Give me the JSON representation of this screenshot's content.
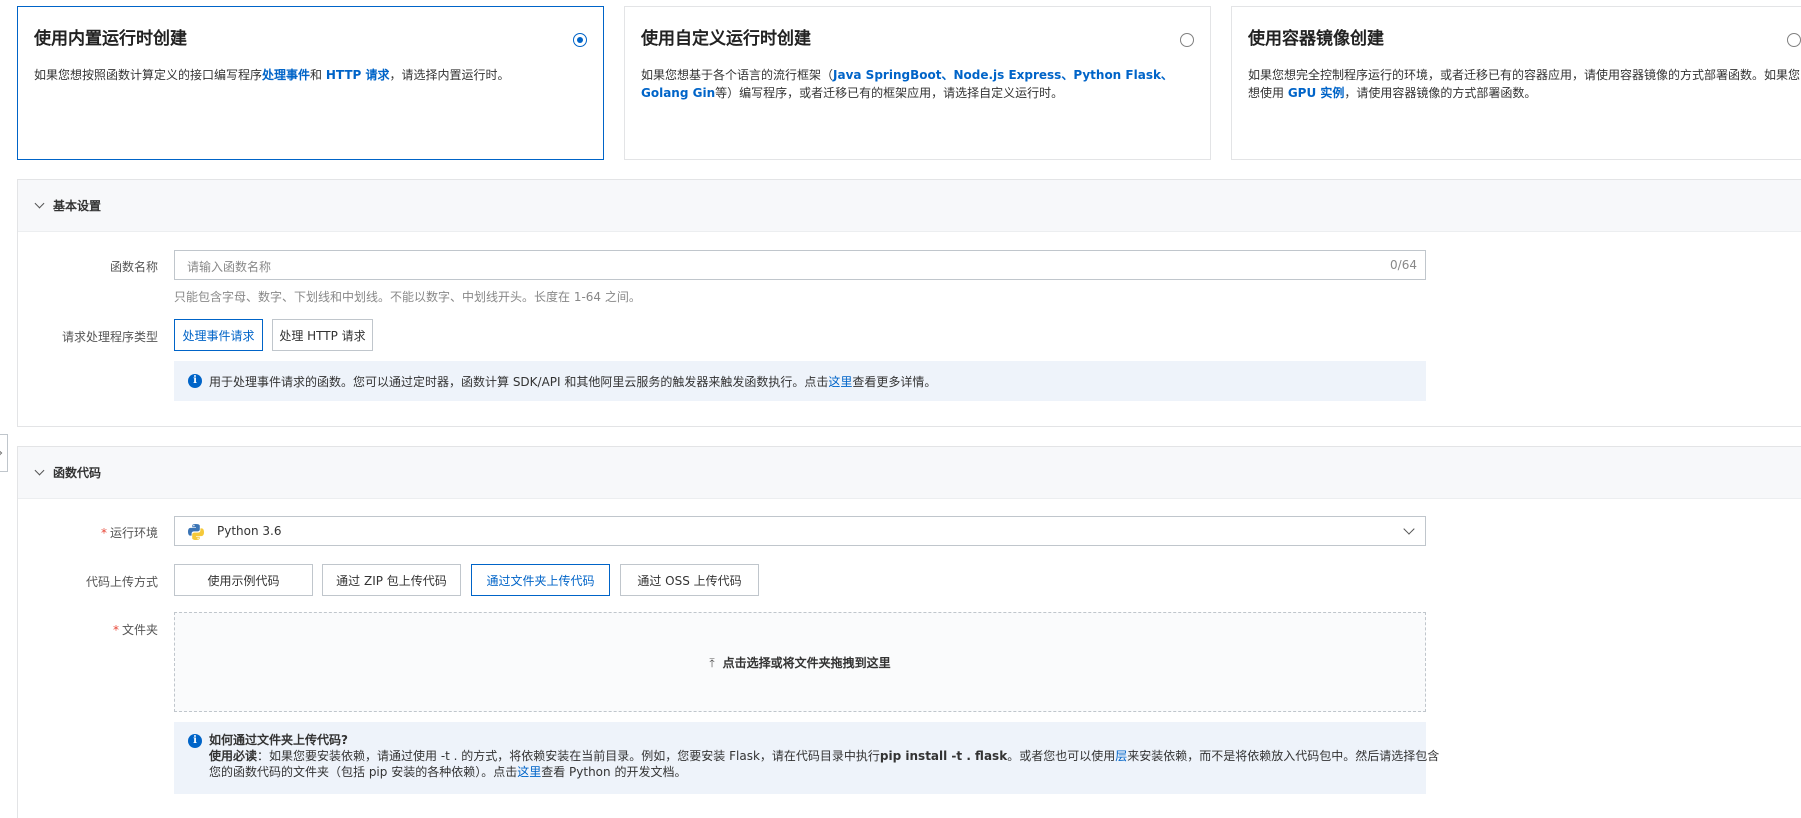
{
  "cards": [
    {
      "title": "使用内置运行时创建",
      "desc_pre": "如果您想按照函数计算定义的接口编写程序",
      "link1": "处理事件",
      "desc_mid": "和 ",
      "link2": "HTTP 请求",
      "desc_post": "，请选择内置运行时。",
      "selected": true
    },
    {
      "title": "使用自定义运行时创建",
      "desc_pre": "如果您想基于各个语言的流行框架（",
      "frameworks": "Java SpringBoot、Node.js Express、Python Flask、Golang Gin",
      "desc_post": "等）编写程序，或者迁移已有的框架应用，请选择自定义运行时。",
      "selected": false
    },
    {
      "title": "使用容器镜像创建",
      "desc_pre": "如果您想完全控制程序运行的环境，或者迁移已有的容器应用，请使用容器镜像的方式部署函数。如果您想使用 ",
      "link1": "GPU 实例",
      "desc_post": "，请使用容器镜像的方式部署函数。",
      "selected": false
    }
  ],
  "basic": {
    "title": "基本设置",
    "name_label": "函数名称",
    "name_placeholder": "请输入函数名称",
    "name_count": "0/64",
    "name_hint": "只能包含字母、数字、下划线和中划线。不能以数字、中划线开头。长度在 1-64 之间。",
    "handler_label": "请求处理程序类型",
    "handler_options": [
      "处理事件请求",
      "处理 HTTP 请求"
    ],
    "notice_pre": "用于处理事件请求的函数。您可以通过定时器，函数计算 SDK/API 和其他阿里云服务的触发器来触发函数执行。点击",
    "notice_link": "这里",
    "notice_post": "查看更多详情。"
  },
  "code": {
    "title": "函数代码",
    "runtime_label": "运行环境",
    "runtime_value": "Python 3.6",
    "upload_label": "代码上传方式",
    "upload_options": [
      "使用示例代码",
      "通过 ZIP 包上传代码",
      "通过文件夹上传代码",
      "通过 OSS 上传代码"
    ],
    "folder_label": "文件夹",
    "dropzone_text": "点击选择或将文件夹拖拽到这里",
    "help_title": "如何通过文件夹上传代码?",
    "help_bold": "使用必读",
    "help_line1_a": "：如果您要安装依赖，请通过使用 -t . 的方式，将依赖安装在当前目录。例如，您要安装 Flask，请在代码目录中执行",
    "help_cmd": "pip install -t . flask",
    "help_line1_b": "。或者您也可以使用",
    "help_link_layer": "层",
    "help_line1_c": "来安装依赖，而不是将依赖放入代码包中。然后请选择包含",
    "help_line2_a": "您的函数代码的文件夹（包括 pip 安装的各种依赖）。点击",
    "help_link_here": "这里",
    "help_line2_b": "查看 Python 的开发文档。"
  },
  "colors": {
    "accent": "#0064c8",
    "required": "#e84738"
  }
}
